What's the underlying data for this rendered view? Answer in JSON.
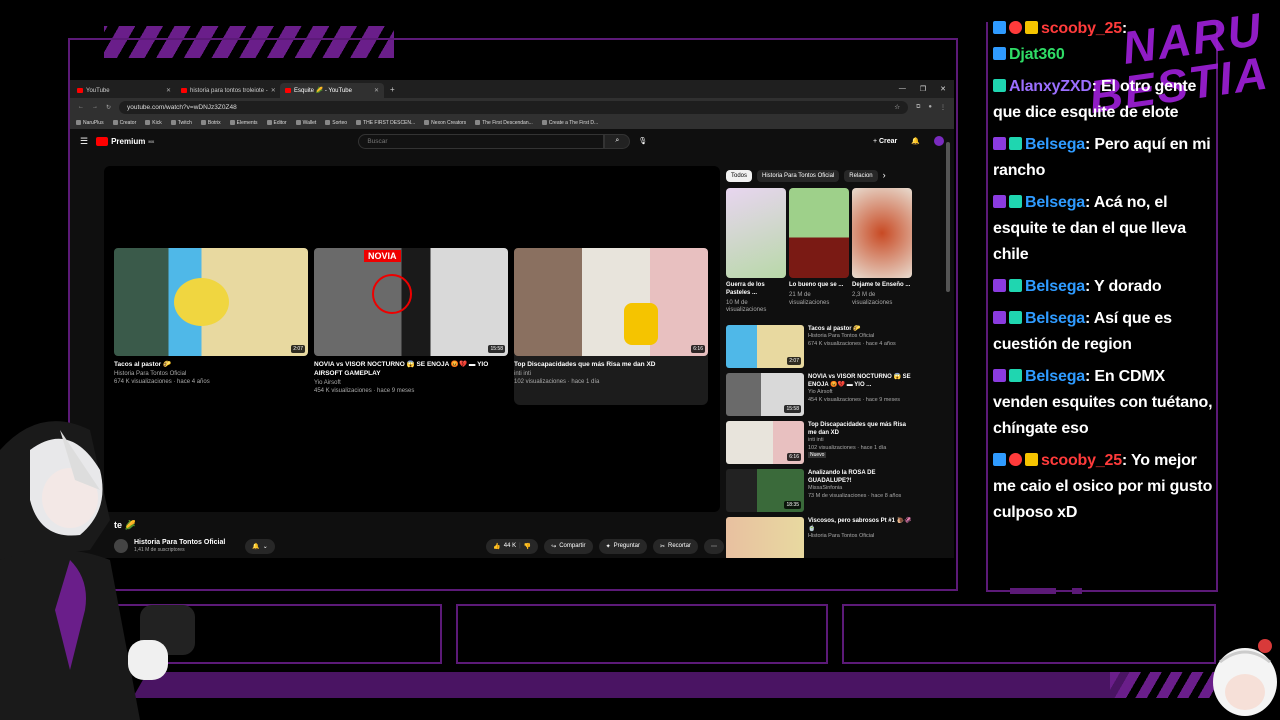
{
  "browser": {
    "tabs": [
      {
        "title": "YouTube",
        "active": false
      },
      {
        "title": "historia para tontos troleiote -",
        "active": false
      },
      {
        "title": "Esquite 🌽 - YouTube",
        "active": true
      }
    ],
    "url": "youtube.com/watch?v=wDNJz3Z0Z48",
    "bookmarks": [
      "NaruPlus",
      "Creator",
      "Kick",
      "Twitch",
      "Botrix",
      "Elements",
      "Editor",
      "Wallet",
      "Sorteo",
      "THE FIRST DESCEN...",
      "Nexon Creators",
      "The First Descendan...",
      "Create a The First D..."
    ]
  },
  "youtube": {
    "logo": "Premium",
    "logo_region": "MX",
    "search_placeholder": "Buscar",
    "create_label": "Crear",
    "endscreen": [
      {
        "title": "Tacos al pastor 🌮",
        "channel": "Historia Para Tontos Oficial",
        "meta": "674 K visualizaciones · hace 4 años",
        "duration": "2:07"
      },
      {
        "title": "NOVIA vs VISOR NOCTURNO 😱 SE ENOJA 😡💔 ▬ YIO AIRSOFT GAMEPLAY",
        "channel": "Yio Airsoft",
        "meta": "454 K visualizaciones · hace 9 meses",
        "duration": "15:58",
        "thumb_text": "NOVIA"
      },
      {
        "title": "Top Discapacidades que más Risa me dan XD",
        "channel": "inti inti",
        "meta": "102 visualizaciones · hace 1 día",
        "duration": "6:16"
      }
    ],
    "video_title_fragment": "te 🌽",
    "channel_name": "Historia Para Tontos Oficial",
    "subscribers": "1,41 M de suscriptores",
    "likes": "44 K",
    "share": "Compartir",
    "ask": "Preguntar",
    "clip": "Recortar",
    "chips": [
      "Todos",
      "Historia Para Tontos Oficial",
      "Relacion"
    ],
    "shorts": [
      {
        "title": "Guerra de los Pasteles ...",
        "views": "10 M de visualizaciones"
      },
      {
        "title": "Lo bueno que se ...",
        "views": "21 M de visualizaciones"
      },
      {
        "title": "Dejame te Enseño ...",
        "views": "2,3 M de visualizaciones"
      }
    ],
    "sidebar_videos": [
      {
        "title": "Tacos al pastor 🌮",
        "channel": "Historia Para Tontos Oficial",
        "meta": "674 K visualizaciones · hace 4 años",
        "duration": "2:07"
      },
      {
        "title": "NOVIA vs VISOR NOCTURNO 😱 SE ENOJA 😡💔 ▬ YIO ...",
        "channel": "Yio Airsoft",
        "meta": "454 K visualizaciones · hace 9 meses",
        "duration": "15:58"
      },
      {
        "title": "Top Discapacidades que más Risa me dan XD",
        "channel": "inti inti",
        "meta": "102 visualizaciones · hace 1 día",
        "badge": "Nuevo",
        "duration": "6:16"
      },
      {
        "title": "Analizando la ROSA DE GUADALUPE?!",
        "channel": "MissaSinfonia",
        "meta": "73 M de visualizaciones · hace 8 años",
        "duration": "18:35"
      },
      {
        "title": "Viscosos, pero sabrosos Pt #1 🐌🦑🍵",
        "channel": "Historia Para Tontos Oficial",
        "meta": "",
        "duration": ""
      }
    ]
  },
  "overlay": {
    "logo_line1": "NARU",
    "logo_line2": "BESTIA"
  },
  "chat": [
    {
      "user": "scooby_25",
      "color": "#ff3b3b",
      "text": ": ",
      "partial": true
    },
    {
      "user": "Djat360",
      "color": "#2fdc66",
      "text": ""
    },
    {
      "user": "AlanxyZXD",
      "color": "#9b6fff",
      "text": ": El otro gente que dice esquite de elote"
    },
    {
      "user": "Belsega",
      "color": "#2f9bff",
      "text": ": Pero aquí en mi rancho"
    },
    {
      "user": "Belsega",
      "color": "#2f9bff",
      "text": ": Acá no, el esquite te dan el que lleva chile"
    },
    {
      "user": "Belsega",
      "color": "#2f9bff",
      "text": ": Y dorado"
    },
    {
      "user": "Belsega",
      "color": "#2f9bff",
      "text": ": Así que es cuestión de region"
    },
    {
      "user": "Belsega",
      "color": "#2f9bff",
      "text": ": En CDMX venden esquites con tuétano, chíngate eso"
    },
    {
      "user": "scooby_25",
      "color": "#ff3b3b",
      "text": ": Yo mejor me caio el osico por mi gusto culposo xD"
    }
  ]
}
